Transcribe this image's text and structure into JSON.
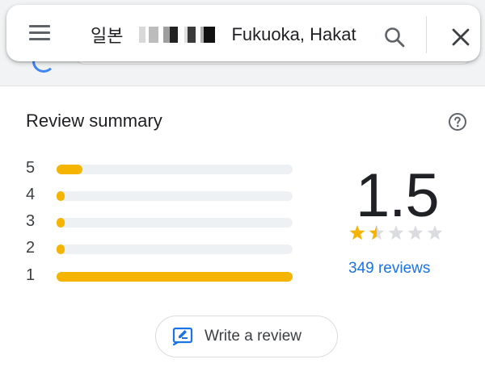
{
  "search": {
    "query_prefix": "일본",
    "query_suffix": "Fukuoka, Hakat"
  },
  "icons": {
    "menu": "hamburger-menu-icon",
    "search": "search-icon",
    "close": "close-icon",
    "help": "help-circle-icon",
    "write": "write-review-icon",
    "star_full": "star-filled-icon",
    "star_empty": "star-empty-icon"
  },
  "review_summary": {
    "title": "Review summary",
    "distribution": [
      {
        "label": "5",
        "fraction": 0.11
      },
      {
        "label": "4",
        "fraction": 0.02
      },
      {
        "label": "3",
        "fraction": 0.03
      },
      {
        "label": "2",
        "fraction": 0.03
      },
      {
        "label": "1",
        "fraction": 1.0
      }
    ],
    "average_rating": "1.5",
    "stars_value": 1.5,
    "stars_total": 5,
    "reviews_count_text": "349 reviews",
    "write_review_label": "Write a review"
  },
  "colors": {
    "bar_fill": "#f4b400",
    "bar_track": "#eef1f4",
    "star_full": "#f4b400",
    "star_empty": "#dadce0",
    "link": "#1a73e8"
  }
}
